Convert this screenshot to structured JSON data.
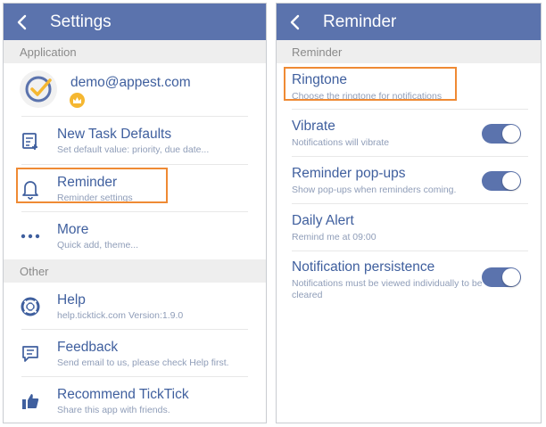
{
  "settings": {
    "title": "Settings",
    "section_application": "Application",
    "account_email": "demo@appest.com",
    "items": [
      {
        "label": "New Task Defaults",
        "sub": "Set default value: priority, due date..."
      },
      {
        "label": "Reminder",
        "sub": "Reminder settings"
      },
      {
        "label": "More",
        "sub": "Quick add, theme..."
      }
    ],
    "section_other": "Other",
    "other_items": [
      {
        "label": "Help",
        "sub": "help.ticktick.com  Version:1.9.0"
      },
      {
        "label": "Feedback",
        "sub": "Send email to us, please check Help first."
      },
      {
        "label": "Recommend TickTick",
        "sub": "Share this app with friends."
      }
    ]
  },
  "reminder": {
    "title": "Reminder",
    "section": "Reminder",
    "ringtone": {
      "label": "Ringtone",
      "sub": "Choose the ringtone for notifications"
    },
    "vibrate": {
      "label": "Vibrate",
      "sub": "Notifications will vibrate",
      "on": true
    },
    "popups": {
      "label": "Reminder pop-ups",
      "sub": "Show pop-ups when reminders coming.",
      "on": true
    },
    "daily": {
      "label": "Daily Alert",
      "sub": "Remind me at 09:00"
    },
    "persistence": {
      "label": "Notification persistence",
      "sub": "Notifications must be viewed individually to be cleared",
      "on": true
    }
  },
  "colors": {
    "header": "#5b73ad",
    "accent_text": "#3f5f9e",
    "highlight": "#ef8a34",
    "badge": "#f5b731"
  }
}
